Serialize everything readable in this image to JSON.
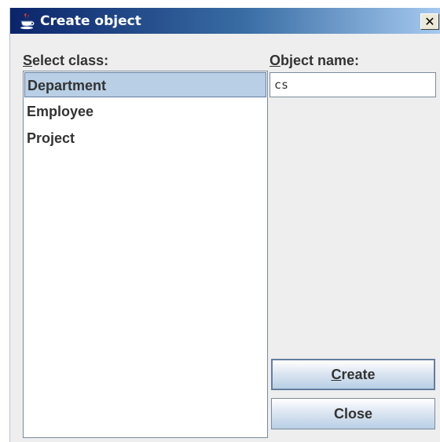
{
  "window": {
    "title": "Create object",
    "close_glyph": "✕"
  },
  "labels": {
    "select_class_mnemonic": "S",
    "select_class_rest": "elect class:",
    "object_name_mnemonic": "O",
    "object_name_rest": "bject name:"
  },
  "class_list": {
    "items": [
      "Department",
      "Employee",
      "Project"
    ],
    "selected": "Department"
  },
  "object_name": {
    "value": "cs"
  },
  "buttons": {
    "create_mnemonic": "C",
    "create_rest": "reate",
    "close_label": "Close"
  },
  "colors": {
    "title_gradient_start": "#0a246a",
    "title_gradient_end": "#a6caf0",
    "selection": "#b8cfe5",
    "window_bg": "#eeeeee"
  },
  "icons": {
    "window_icon": "java-cup-icon",
    "close": "close-icon"
  }
}
